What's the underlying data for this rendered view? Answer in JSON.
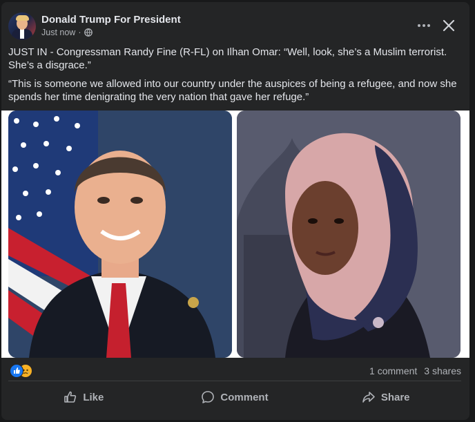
{
  "post": {
    "page_name": "Donald Trump For President",
    "timestamp": "Just now",
    "separator": "·",
    "audience_icon": "globe-icon",
    "paragraph_1": "JUST IN - Congressman Randy Fine (R-FL) on Ilhan Omar: “Well, look, she’s a Muslim terrorist. She’s a disgrace.”",
    "paragraph_2": "“This is someone we allowed into our country under the auspices of being a refugee, and now she spends her time denigrating the very nation that gave her refuge.”"
  },
  "header_icons": {
    "more": "more-horizontal-icon",
    "close": "close-icon"
  },
  "engagement": {
    "reactions": [
      "like",
      "sad"
    ],
    "comments": "1 comment",
    "shares": "3 shares"
  },
  "actions": {
    "like": "Like",
    "comment": "Comment",
    "share": "Share"
  },
  "colors": {
    "background": "#18191a",
    "card": "#242526",
    "text_primary": "#e4e6eb",
    "text_secondary": "#b0b3b8",
    "like_blue": "#1877f2",
    "sad_yellow": "#f7b125"
  }
}
